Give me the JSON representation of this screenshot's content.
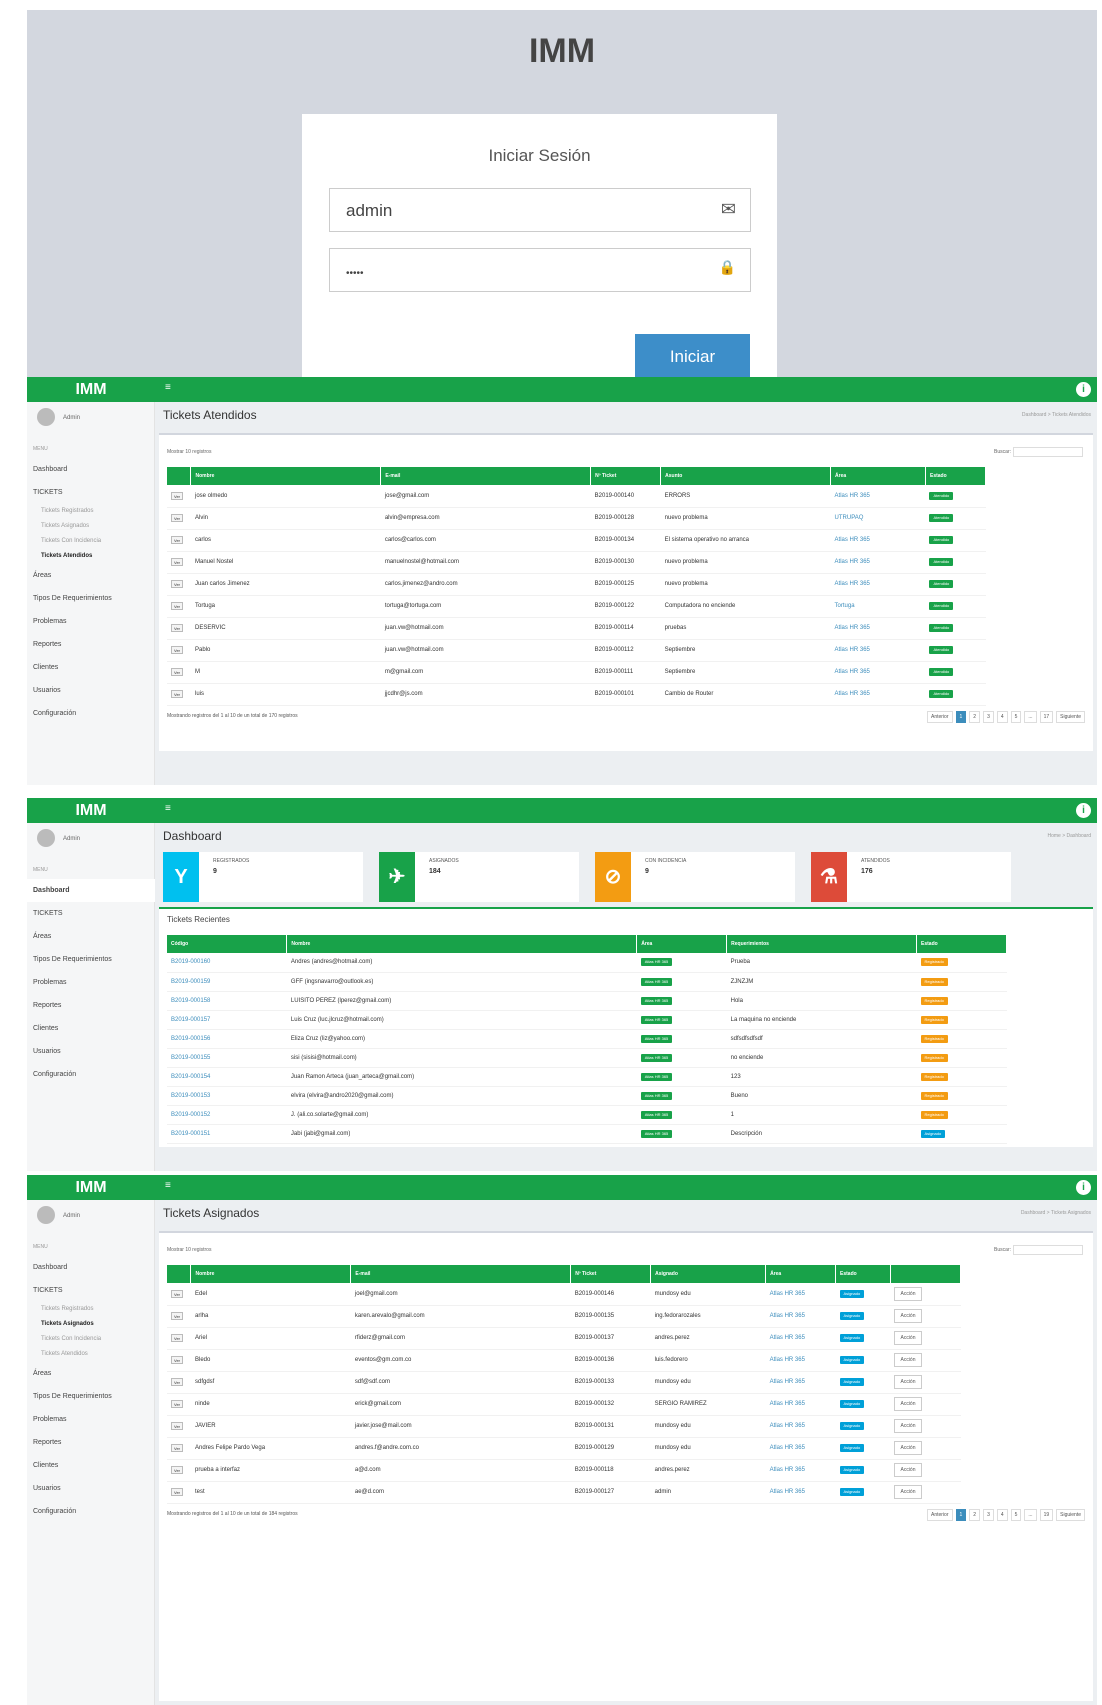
{
  "login": {
    "brand": "IMM",
    "title": "Iniciar Sesión",
    "username": "admin",
    "password": "•••••",
    "submit": "Iniciar",
    "mail_icon": "✉",
    "lock_icon": "🔒"
  },
  "common": {
    "brand": "IMM",
    "menu_icon": "≡",
    "user_initial": "i"
  },
  "atendidos": {
    "title": "Tickets Atendidos",
    "breadcrumb": "Dashboard > Tickets Atendidos",
    "show": "Mostrar 10 registros",
    "search": "Buscar:",
    "headers": [
      "",
      "Nombre",
      "E-mail",
      "Nº Ticket",
      "Asunto",
      "Área",
      "Estado"
    ],
    "rows": [
      [
        "Ver",
        "jose olmedo",
        "jose@gmail.com",
        "B2019-000140",
        "ERRORS",
        "Atlas HR 365",
        "Atendido"
      ],
      [
        "Ver",
        "Alvin",
        "alvin@empresa.com",
        "B2019-000128",
        "nuevo problema",
        "UTRUPAQ",
        "Atendido"
      ],
      [
        "Ver",
        "carlos",
        "carlos@carlos.com",
        "B2019-000134",
        "El sistema operativo no arranca",
        "Atlas HR 365",
        "Atendido"
      ],
      [
        "Ver",
        "Manuel Nostel",
        "manuelnostel@hotmail.com",
        "B2019-000130",
        "nuevo problema",
        "Atlas HR 365",
        "Atendido"
      ],
      [
        "Ver",
        "Juan carlos Jimenez",
        "carlos.jimenez@andro.com",
        "B2019-000125",
        "nuevo problema",
        "Atlas HR 365",
        "Atendido"
      ],
      [
        "Ver",
        "Tortuga",
        "tortuga@tortuga.com",
        "B2019-000122",
        "Computadora no enciende",
        "Tortuga",
        "Atendido"
      ],
      [
        "Ver",
        "DESERVIC",
        "juan.vw@hotmail.com",
        "B2019-000114",
        "pruebas",
        "Atlas HR 365",
        "Atendido"
      ],
      [
        "Ver",
        "Pablo",
        "juan.vw@hotmail.com",
        "B2019-000112",
        "Septiembre",
        "Atlas HR 365",
        "Atendido"
      ],
      [
        "Ver",
        "M",
        "m@gmail.com",
        "B2019-000111",
        "Septiembre",
        "Atlas HR 365",
        "Atendido"
      ],
      [
        "Ver",
        "luis",
        "jjcdhr@js.com",
        "B2019-000101",
        "Cambio de Router",
        "Atlas HR 365",
        "Atendido"
      ]
    ],
    "footer": "Mostrando registros del 1 al 10 de un total de 170 registros",
    "pager": [
      "Anterior",
      "1",
      "2",
      "3",
      "4",
      "5",
      "...",
      "17",
      "Siguiente"
    ]
  },
  "dashboard": {
    "title": "Dashboard",
    "breadcrumb": "Home > Dashboard",
    "stats": [
      {
        "label": "REGISTRADOS",
        "value": "9",
        "color": "#00c0ef",
        "icon": "Y"
      },
      {
        "label": "ASIGNADOS",
        "value": "184",
        "color": "#18a249",
        "icon": "✈"
      },
      {
        "label": "CON INCIDENCIA",
        "value": "9",
        "color": "#f39c12",
        "icon": "⊘"
      },
      {
        "label": "ATENDIDOS",
        "value": "176",
        "color": "#dd4b39",
        "icon": "⚗"
      }
    ],
    "recent_title": "Tickets Recientes",
    "headers": [
      "Código",
      "Nombre",
      "Área",
      "Requerimientos",
      "Estado"
    ],
    "rows": [
      [
        "B2019-000160",
        "Andres (andres@hotmail.com)",
        "Atlas HR 365",
        "Prueba",
        "Registrado"
      ],
      [
        "B2019-000159",
        "GFF (ingsnavarro@outlook.es)",
        "Atlas HR 365",
        "ZJNZJM",
        "Registrado"
      ],
      [
        "B2019-000158",
        "LUISITO PEREZ (lperez@gmail.com)",
        "Atlas HR 365",
        "Hola",
        "Registrado"
      ],
      [
        "B2019-000157",
        "Luis Cruz (luc.jlcruz@hotmail.com)",
        "Atlas HR 365",
        "La maquina no enciende",
        "Registrado"
      ],
      [
        "B2019-000156",
        "Eliza Cruz (liz@yahoo.com)",
        "Atlas HR 365",
        "sdfsdfsdfsdf",
        "Registrado"
      ],
      [
        "B2019-000155",
        "sisi (sisisi@hotmail.com)",
        "Atlas HR 365",
        "no enciende",
        "Registrado"
      ],
      [
        "B2019-000154",
        "Juan Ramon Arteca (juan_arteca@gmail.com)",
        "Atlas HR 365",
        "123",
        "Registrado"
      ],
      [
        "B2019-000153",
        "elvira (elvira@andro2020@gmail.com)",
        "Atlas HR 365",
        "Bueno",
        "Registrado"
      ],
      [
        "B2019-000152",
        "J. (ali.co.solarte@gmail.com)",
        "Atlas HR 365",
        "1",
        "Registrado"
      ],
      [
        "B2019-000151",
        "Jabi (jabi@gmail.com)",
        "Atlas HR 365",
        "Descripción",
        "Asignado"
      ]
    ]
  },
  "asignados": {
    "title": "Tickets Asignados",
    "breadcrumb": "Dashboard > Tickets Asignados",
    "show": "Mostrar 10 registros",
    "search": "Buscar:",
    "headers": [
      "",
      "Nombre",
      "E-mail",
      "Nº Ticket",
      "Asignado",
      "Área",
      "Estado",
      ""
    ],
    "rows": [
      [
        "Ver",
        "Edel",
        "joel@gmail.com",
        "B2019-000146",
        "mundosy edu",
        "Atlas HR 365",
        "Asignado",
        "Acción"
      ],
      [
        "Ver",
        "arlha",
        "karen.arevalo@gmail.com",
        "B2019-000135",
        "ing.fedorarozales",
        "Atlas HR 365",
        "Asignado",
        "Acción"
      ],
      [
        "Ver",
        "Ariel",
        "rfiderz@gmail.com",
        "B2019-000137",
        "andres.perez",
        "Atlas HR 365",
        "Asignado",
        "Acción"
      ],
      [
        "Ver",
        "Bledo",
        "eventos@gm.com.co",
        "B2019-000136",
        "luis.fedorero",
        "Atlas HR 365",
        "Asignado",
        "Acción"
      ],
      [
        "Ver",
        "sdfgdsf",
        "sdf@sdf.com",
        "B2019-000133",
        "mundosy edu",
        "Atlas HR 365",
        "Asignado",
        "Acción"
      ],
      [
        "Ver",
        "ninde",
        "erick@gmail.com",
        "B2019-000132",
        "SERGIO RAMIREZ",
        "Atlas HR 365",
        "Asignado",
        "Acción"
      ],
      [
        "Ver",
        "JAVIER",
        "javier.jose@mail.com",
        "B2019-000131",
        "mundosy edu",
        "Atlas HR 365",
        "Asignado",
        "Acción"
      ],
      [
        "Ver",
        "Andres Felipe Pardo Vega",
        "andres.f@andre.com.co",
        "B2019-000129",
        "mundosy edu",
        "Atlas HR 365",
        "Asignado",
        "Acción"
      ],
      [
        "Ver",
        "prueba a interfaz",
        "a@d.com",
        "B2019-000118",
        "andres.perez",
        "Atlas HR 365",
        "Asignado",
        "Acción"
      ],
      [
        "Ver",
        "test",
        "ae@d.com",
        "B2019-000127",
        "admin",
        "Atlas HR 365",
        "Asignado",
        "Acción"
      ]
    ],
    "footer": "Mostrando registros del 1 al 10 de un total de 184 registros",
    "pager": [
      "Anterior",
      "1",
      "2",
      "3",
      "4",
      "5",
      "...",
      "19",
      "Siguiente"
    ]
  },
  "sidebar": {
    "user": "Admin",
    "header": "MENU",
    "dashboard": "Dashboard",
    "tickets": "TICKETS",
    "subs": [
      "Tickets Registrados",
      "Tickets Asignados",
      "Tickets Con Incidencia",
      "Tickets Atendidos"
    ],
    "items": [
      "Áreas",
      "Tipos De Requerimientos",
      "Problemas",
      "Reportes",
      "Clientes",
      "Usuarios",
      "Configuración"
    ]
  }
}
